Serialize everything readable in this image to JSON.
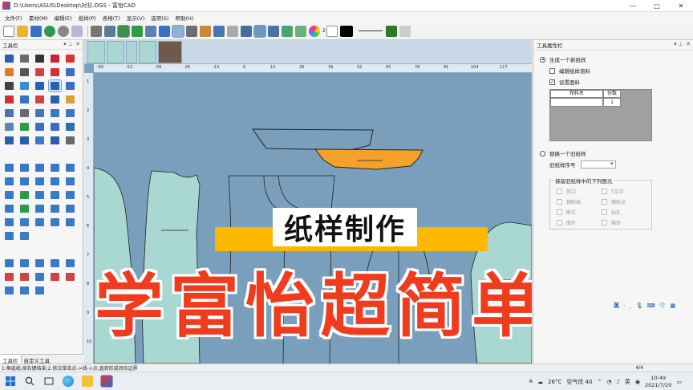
{
  "window": {
    "title": "D:\\Users\\ASUS\\Desktop\\衬衫.DGS - 富怡CAD",
    "minimize": "—",
    "maximize": "□",
    "close": "✕"
  },
  "menu": [
    "文件(F)",
    "素材(M)",
    "编辑(E)",
    "纸样(P)",
    "表格(T)",
    "显示(V)",
    "选项(S)",
    "帮助(H)"
  ],
  "toolbar": {
    "number_label": "2"
  },
  "left_panel": {
    "title": "工具栏",
    "pin": "▾ ⊥",
    "close": "✕",
    "tabs": [
      "工具栏",
      "自定义工具"
    ]
  },
  "canvas": {
    "ruler_labels": [
      "-65",
      "-52",
      "-39",
      "-26",
      "-13",
      "0",
      "13",
      "26",
      "39",
      "52",
      "65",
      "78",
      "91",
      "104",
      "117"
    ],
    "ruler_v_labels": [
      "1",
      "2",
      "3",
      "4",
      "5",
      "6",
      "7",
      "8",
      "9",
      "10"
    ],
    "banner_small": "纸样制作",
    "banner_big": "学富怡超简单"
  },
  "right_panel": {
    "title": "工具属性栏",
    "pin": "▾ ⊥",
    "close": "✕",
    "opt_new": "生成一个新纸样",
    "opt_edit": "编辑纸样资料",
    "opt_fabric": "设置面料",
    "fabric_headers": [
      "布料名",
      "份数"
    ],
    "fabric_count": "1",
    "opt_replace": "替换一个旧纸样",
    "old_label": "旧纸样序号",
    "keep_title": "保留旧纸样中的下列图元",
    "keep_options": [
      "剪口",
      "T文字",
      "辅助线",
      "辅助点",
      "断位",
      "钻孔",
      "图片",
      "缝份"
    ],
    "ime": [
      "英",
      "·",
      "¸",
      "🎙",
      "⌨",
      "👕",
      "▦"
    ]
  },
  "status": {
    "hint": "1.框选线,按右键结束;2.依次单击点->线->点,直到形成闭合边界",
    "page": "4/4"
  },
  "taskbar": {
    "weather_temp": "26°C",
    "air_quality": "空气优 40",
    "ime": "英",
    "time": "10:49",
    "date": "2021/7/20"
  },
  "colors": {
    "canvas_bg": "#7a9fbd",
    "piece_fill": "#a9d7d2",
    "highlight_piece": "#f3a12a",
    "banner_yellow": "#ffb800",
    "title_red": "#f03c1e"
  }
}
